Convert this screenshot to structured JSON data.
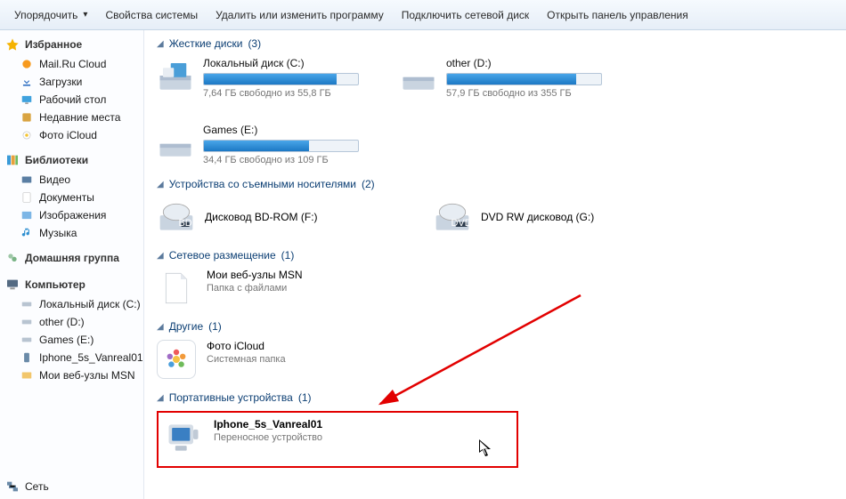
{
  "toolbar": {
    "organize": "Упорядочить",
    "sys_props": "Свойства системы",
    "uninstall": "Удалить или изменить программу",
    "map_drive": "Подключить сетевой диск",
    "control_panel": "Открыть панель управления"
  },
  "sidebar": {
    "favorites": {
      "heading": "Избранное",
      "items": [
        {
          "label": "Mail.Ru Cloud"
        },
        {
          "label": "Загрузки"
        },
        {
          "label": "Рабочий стол"
        },
        {
          "label": "Недавние места"
        },
        {
          "label": "Фото iCloud"
        }
      ]
    },
    "libraries": {
      "heading": "Библиотеки",
      "items": [
        {
          "label": "Видео"
        },
        {
          "label": "Документы"
        },
        {
          "label": "Изображения"
        },
        {
          "label": "Музыка"
        }
      ]
    },
    "homegroup": {
      "heading": "Домашняя группа"
    },
    "computer": {
      "heading": "Компьютер",
      "items": [
        {
          "label": "Локальный диск (C:)"
        },
        {
          "label": "other (D:)"
        },
        {
          "label": "Games (E:)"
        },
        {
          "label": "Iphone_5s_Vanreal01"
        },
        {
          "label": "Мои веб-узлы MSN"
        }
      ]
    },
    "network": {
      "heading": "Сеть"
    }
  },
  "sections": {
    "hdd": {
      "title": "Жесткие диски",
      "count": "(3)",
      "drives": [
        {
          "name": "Локальный диск (C:)",
          "free": "7,64 ГБ свободно из 55,8 ГБ",
          "fill_pct": 86
        },
        {
          "name": "other (D:)",
          "free": "57,9 ГБ свободно из 355 ГБ",
          "fill_pct": 84
        },
        {
          "name": "Games (E:)",
          "free": "34,4 ГБ свободно из 109 ГБ",
          "fill_pct": 68
        }
      ]
    },
    "removable": {
      "title": "Устройства со съемными носителями",
      "count": "(2)",
      "devices": [
        {
          "name": "Дисковод BD-ROM (F:)"
        },
        {
          "name": "DVD RW дисковод (G:)"
        }
      ]
    },
    "network": {
      "title": "Сетевое размещение",
      "count": "(1)",
      "item": {
        "name": "Мои веб-узлы MSN",
        "sub": "Папка с файлами"
      }
    },
    "other": {
      "title": "Другие",
      "count": "(1)",
      "item": {
        "name": "Фото iCloud",
        "sub": "Системная папка"
      }
    },
    "portable": {
      "title": "Портативные устройства",
      "count": "(1)",
      "item": {
        "name": "Iphone_5s_Vanreal01",
        "sub": "Переносное устройство"
      }
    }
  }
}
